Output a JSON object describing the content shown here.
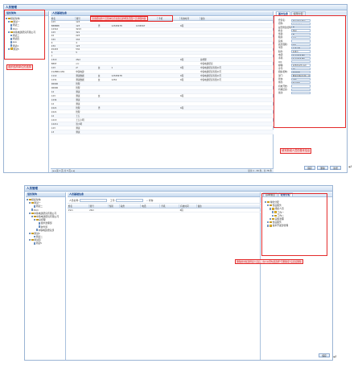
{
  "top": {
    "window_title": "人员管理",
    "tree_header": "组织架构",
    "tree": [
      {
        "label": "组织架构",
        "indent": 0,
        "kind": "folder"
      },
      {
        "label": "测试一",
        "indent": 1,
        "kind": "folder"
      },
      {
        "label": "测试二",
        "indent": 1,
        "kind": "doc"
      },
      {
        "label": "2Sm",
        "indent": 1,
        "kind": "doc"
      },
      {
        "label": "中铁电建研究有限公司",
        "indent": 1,
        "kind": "folder"
      },
      {
        "label": "测试三",
        "indent": 1,
        "kind": "doc"
      },
      {
        "label": "测试四",
        "indent": 1,
        "kind": "doc"
      },
      {
        "label": "aaa",
        "indent": 1,
        "kind": "doc"
      },
      {
        "label": "测试4",
        "indent": 1,
        "kind": "doc"
      },
      {
        "label": "测试5",
        "indent": 1,
        "kind": "folder"
      }
    ],
    "tree_annotation": "组织结构单位的选择",
    "list_header": "人员基础信息",
    "list_annotation": "双击组织的人员基本信息双击后的修改页面人员详细内容",
    "columns": [
      "姓名",
      "账号",
      "性别",
      "职务",
      "电话",
      "手机",
      "有效时间",
      "备注"
    ],
    "rows": [
      [
        "123",
        "123",
        "",
        "",
        "",
        "",
        "",
        ""
      ],
      [
        "888888",
        "123",
        "男",
        "12345678",
        "1234567",
        "",
        "6程",
        ""
      ],
      [
        "12312",
        "3213",
        "",
        "",
        "",
        "",
        "",
        ""
      ],
      [
        "123",
        "321",
        "",
        "",
        "",
        "",
        "",
        ""
      ],
      [
        "22",
        "223",
        "",
        "",
        "",
        "",
        "",
        ""
      ],
      [
        "333",
        "333",
        "",
        "",
        "",
        "",
        "",
        ""
      ],
      [
        "4",
        "4",
        "",
        "",
        "",
        "",
        "",
        ""
      ],
      [
        "234",
        "123",
        "",
        "",
        "",
        "",
        "",
        ""
      ],
      [
        "45433",
        "532",
        "",
        "",
        "",
        "",
        "",
        ""
      ],
      [
        "5",
        "5",
        "",
        "",
        "",
        "",
        "",
        ""
      ],
      [
        "s",
        "",
        "",
        "",
        "",
        "",
        "",
        ""
      ],
      [
        "1313",
        "dfsd",
        "",
        "",
        "",
        "",
        "6程",
        "总经理"
      ],
      [
        "8897",
        "ccc",
        "",
        "",
        "",
        "",
        "",
        "中铁电建研究"
      ],
      [
        "123",
        "zf",
        "女",
        "1",
        "",
        "",
        "6程",
        "中铁电建研究有限公司"
      ],
      [
        "2128811181",
        "中铁电建",
        "",
        "",
        "",
        "",
        "",
        "中铁电建研究有限公司"
      ],
      [
        "1112",
        "测试数据",
        "女",
        "12345678",
        "",
        "",
        "6程",
        "中铁电建研究有限公司"
      ],
      [
        "1231",
        "测试数据",
        "女",
        "1234",
        "",
        "",
        "6程",
        "中铁电建研究有限公司"
      ],
      [
        "06006",
        "管理",
        "",
        "",
        "",
        "",
        "",
        ""
      ],
      [
        "06006",
        "管理",
        "",
        "",
        "",
        "",
        "",
        ""
      ],
      [
        "12",
        "测试",
        "",
        "",
        "",
        "",
        "",
        ""
      ],
      [
        "123",
        "测试",
        "女",
        "",
        "",
        "",
        "6程",
        ""
      ],
      [
        "1234",
        "测试",
        "",
        "",
        "",
        "",
        "",
        ""
      ],
      [
        "12",
        "测试",
        "",
        "",
        "",
        "",
        "",
        ""
      ],
      [
        "2221",
        "管理",
        "男",
        "",
        "",
        "",
        "6程",
        ""
      ],
      [
        "2221",
        "管理",
        "",
        "",
        "",
        "",
        "",
        ""
      ],
      [
        "12",
        "王五",
        "",
        "",
        "",
        "",
        "",
        ""
      ],
      [
        "1213",
        "王五小明",
        "",
        "",
        "",
        "",
        "",
        ""
      ],
      [
        "12211",
        "张小明",
        "",
        "",
        "",
        "",
        "",
        ""
      ],
      [
        "123",
        "测试",
        "",
        "",
        "",
        "",
        "",
        ""
      ],
      [
        "13",
        "测试",
        "",
        "",
        "",
        "",
        "",
        ""
      ]
    ],
    "pager_text": "第 1 页 共 3 页",
    "pager_right": "显示 1 - 30 条，共 78 条",
    "tabs": [
      "基本信息",
      "权限分配"
    ],
    "form": [
      {
        "label": "登录名:",
        "value": "2Sm2Sm2Sm"
      },
      {
        "label": "密码:",
        "value": "••••••••"
      },
      {
        "label": "是否修改密码:",
        "value": "是"
      },
      {
        "label": "姓名:",
        "value": "2Sm"
      },
      {
        "label": "性别:",
        "value": "男"
      },
      {
        "label": "籍贯:",
        "value": "广东"
      },
      {
        "label": "民族:",
        "value": ""
      },
      {
        "label": "政治面貌:",
        "value": "团员"
      },
      {
        "label": "学历:",
        "value": "技术员类"
      },
      {
        "label": "职务:",
        "value": "技术员"
      },
      {
        "label": "电话:",
        "value": "0123456789"
      },
      {
        "label": "手机:",
        "value": "0123456789"
      },
      {
        "label": "QQ:",
        "value": ""
      },
      {
        "label": "邮箱:",
        "value": "123@123.com"
      },
      {
        "label": "序号:",
        "value": "10"
      },
      {
        "label": "组织机构:",
        "value": "组织架构"
      },
      {
        "label": "部门:",
        "value": "重集团建研有限公司"
      },
      {
        "label": "状态:",
        "value": "在职"
      },
      {
        "label": "角色:",
        "value": "售后服务"
      },
      {
        "label": "有效开始:",
        "value": ""
      },
      {
        "label": "有效结束:",
        "value": ""
      },
      {
        "label": "备注:",
        "value": ""
      }
    ],
    "form_annotation": "填写新增人员的基本信息",
    "buttons": [
      "保存",
      "删除",
      "新增"
    ]
  },
  "bottom": {
    "window_title": "人员管理",
    "tree_header": "组织架构",
    "tree": [
      {
        "label": "组织架构",
        "indent": 0,
        "kind": "folder"
      },
      {
        "label": "测试一",
        "indent": 1,
        "kind": "folder"
      },
      {
        "label": "测试二",
        "indent": 2,
        "kind": "doc"
      },
      {
        "label": "2Sm",
        "indent": 1,
        "kind": "doc"
      },
      {
        "label": "中铁电建研究有限公司",
        "indent": 1,
        "kind": "folder"
      },
      {
        "label": "中铁电建研究有限公司",
        "indent": 2,
        "kind": "folder"
      },
      {
        "label": "总经理",
        "indent": 3,
        "kind": "folder"
      },
      {
        "label": "技术监理部",
        "indent": 4,
        "kind": "doc"
      },
      {
        "label": "财务部",
        "indent": 4,
        "kind": "doc"
      },
      {
        "label": "中铁电建研究部",
        "indent": 3,
        "kind": "doc"
      },
      {
        "label": "测试4",
        "indent": 1,
        "kind": "folder"
      },
      {
        "label": "测试二",
        "indent": 2,
        "kind": "doc"
      },
      {
        "label": "测试四",
        "indent": 1,
        "kind": "folder"
      },
      {
        "label": "测试5",
        "indent": 2,
        "kind": "doc"
      }
    ],
    "list_header": "人员基础信息",
    "search_label": "人员名称:",
    "search_value": "",
    "search_label2": "工号:",
    "search_button": "查询",
    "columns": [
      "姓名",
      "账号",
      "性别",
      "职务",
      "电话",
      "手机",
      "有效时间",
      "备注"
    ],
    "rows": [
      [
        "2Sm",
        "2Sm",
        "",
        "",
        "",
        "",
        "6程",
        ""
      ]
    ],
    "tabs": [
      "基本信息",
      "权限分配"
    ],
    "perm_tree": [
      {
        "label": "角色分配",
        "indent": 0
      },
      {
        "label": "售后服务",
        "indent": 1
      },
      {
        "label": "组织人员",
        "indent": 2
      },
      {
        "label": "工作一",
        "indent": 3
      },
      {
        "label": "工作二",
        "indent": 3
      },
      {
        "label": "实施监理",
        "indent": 2
      },
      {
        "label": "售后服务",
        "indent": 1
      },
      {
        "label": "技术开发部管理",
        "indent": 1
      }
    ],
    "annotation": "删除的时候选择完人员后，在role里勾选选择“可删除项”后直接删除",
    "button": "保存"
  }
}
